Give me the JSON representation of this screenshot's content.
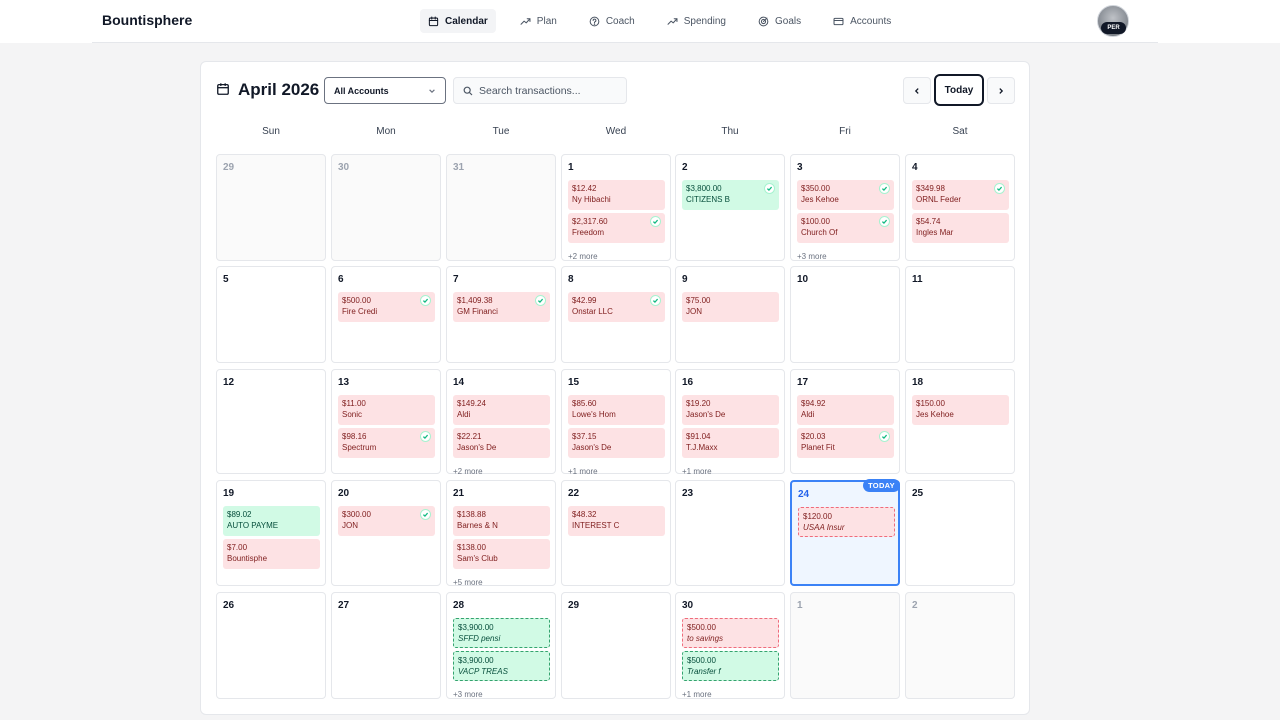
{
  "app": {
    "title": "Bountisphere"
  },
  "nav": [
    {
      "label": "Calendar",
      "icon": "calendar-icon",
      "active": true
    },
    {
      "label": "Plan",
      "icon": "trending-up-icon"
    },
    {
      "label": "Coach",
      "icon": "coach-icon"
    },
    {
      "label": "Spending",
      "icon": "trending-up-icon"
    },
    {
      "label": "Goals",
      "icon": "target-icon"
    },
    {
      "label": "Accounts",
      "icon": "credit-card-icon"
    }
  ],
  "user": {
    "badge": "PER"
  },
  "toolbar": {
    "month": "April 2026",
    "account_filter": "All Accounts",
    "search_placeholder": "Search transactions...",
    "today_label": "Today"
  },
  "weekdays": [
    "Sun",
    "Mon",
    "Tue",
    "Wed",
    "Thu",
    "Fri",
    "Sat"
  ],
  "today_badge": "TODAY",
  "days": [
    {
      "num": "29",
      "other": true,
      "txns": []
    },
    {
      "num": "30",
      "other": true,
      "txns": []
    },
    {
      "num": "31",
      "other": true,
      "txns": []
    },
    {
      "num": "1",
      "txns": [
        {
          "amount": "$12.42",
          "name": "Ny Hibachi",
          "type": "expense"
        },
        {
          "amount": "$2,317.60",
          "name": "Freedom",
          "type": "expense",
          "cleared": true
        }
      ],
      "more": "+2 more"
    },
    {
      "num": "2",
      "txns": [
        {
          "amount": "$3,800.00",
          "name": "CITIZENS B",
          "type": "income",
          "cleared": true
        }
      ]
    },
    {
      "num": "3",
      "txns": [
        {
          "amount": "$350.00",
          "name": "Jes Kehoe",
          "type": "expense",
          "cleared": true
        },
        {
          "amount": "$100.00",
          "name": "Church Of",
          "type": "expense",
          "cleared": true
        }
      ],
      "more": "+3 more"
    },
    {
      "num": "4",
      "txns": [
        {
          "amount": "$349.98",
          "name": "ORNL Feder",
          "type": "expense",
          "cleared": true
        },
        {
          "amount": "$54.74",
          "name": "Ingles Mar",
          "type": "expense"
        }
      ]
    },
    {
      "num": "5",
      "txns": []
    },
    {
      "num": "6",
      "txns": [
        {
          "amount": "$500.00",
          "name": "Fire Credi",
          "type": "expense",
          "cleared": true
        }
      ]
    },
    {
      "num": "7",
      "txns": [
        {
          "amount": "$1,409.38",
          "name": "GM Financi",
          "type": "expense",
          "cleared": true
        }
      ]
    },
    {
      "num": "8",
      "txns": [
        {
          "amount": "$42.99",
          "name": "Onstar LLC",
          "type": "expense",
          "cleared": true
        }
      ]
    },
    {
      "num": "9",
      "txns": [
        {
          "amount": "$75.00",
          "name": "JON",
          "type": "expense"
        }
      ]
    },
    {
      "num": "10",
      "txns": []
    },
    {
      "num": "11",
      "txns": []
    },
    {
      "num": "12",
      "txns": []
    },
    {
      "num": "13",
      "txns": [
        {
          "amount": "$11.00",
          "name": "Sonic",
          "type": "expense"
        },
        {
          "amount": "$98.16",
          "name": "Spectrum",
          "type": "expense",
          "cleared": true
        }
      ]
    },
    {
      "num": "14",
      "txns": [
        {
          "amount": "$149.24",
          "name": "Aldi",
          "type": "expense"
        },
        {
          "amount": "$22.21",
          "name": "Jason's De",
          "type": "expense"
        }
      ],
      "more": "+2 more"
    },
    {
      "num": "15",
      "txns": [
        {
          "amount": "$85.60",
          "name": "Lowe's Hom",
          "type": "expense"
        },
        {
          "amount": "$37.15",
          "name": "Jason's De",
          "type": "expense"
        }
      ],
      "more": "+1 more"
    },
    {
      "num": "16",
      "txns": [
        {
          "amount": "$19.20",
          "name": "Jason's De",
          "type": "expense"
        },
        {
          "amount": "$91.04",
          "name": "T.J.Maxx",
          "type": "expense"
        }
      ],
      "more": "+1 more"
    },
    {
      "num": "17",
      "txns": [
        {
          "amount": "$94.92",
          "name": "Aldi",
          "type": "expense"
        },
        {
          "amount": "$20.03",
          "name": "Planet Fit",
          "type": "expense",
          "cleared": true
        }
      ]
    },
    {
      "num": "18",
      "txns": [
        {
          "amount": "$150.00",
          "name": "Jes Kehoe",
          "type": "expense"
        }
      ]
    },
    {
      "num": "19",
      "txns": [
        {
          "amount": "$89.02",
          "name": "AUTO PAYME",
          "type": "income"
        },
        {
          "amount": "$7.00",
          "name": "Bountisphe",
          "type": "expense"
        }
      ]
    },
    {
      "num": "20",
      "txns": [
        {
          "amount": "$300.00",
          "name": "JON",
          "type": "expense",
          "cleared": true
        }
      ]
    },
    {
      "num": "21",
      "txns": [
        {
          "amount": "$138.88",
          "name": "Barnes & N",
          "type": "expense"
        },
        {
          "amount": "$138.00",
          "name": "Sam's Club",
          "type": "expense"
        }
      ],
      "more": "+5 more"
    },
    {
      "num": "22",
      "txns": [
        {
          "amount": "$48.32",
          "name": "INTEREST C",
          "type": "expense"
        }
      ]
    },
    {
      "num": "23",
      "txns": []
    },
    {
      "num": "24",
      "today": true,
      "txns": [
        {
          "amount": "$120.00",
          "name": "USAA Insur",
          "type": "expense",
          "pending": true
        }
      ]
    },
    {
      "num": "25",
      "txns": []
    },
    {
      "num": "26",
      "txns": []
    },
    {
      "num": "27",
      "txns": []
    },
    {
      "num": "28",
      "txns": [
        {
          "amount": "$3,900.00",
          "name": "SFFD pensi",
          "type": "income",
          "pending": true
        },
        {
          "amount": "$3,900.00",
          "name": "VACP TREAS",
          "type": "income",
          "pending": true
        }
      ],
      "more": "+3 more"
    },
    {
      "num": "29",
      "txns": []
    },
    {
      "num": "30",
      "txns": [
        {
          "amount": "$500.00",
          "name": "to savings",
          "type": "expense",
          "pending": true
        },
        {
          "amount": "$500.00",
          "name": "Transfer f",
          "type": "income",
          "pending": true
        }
      ],
      "more": "+1 more"
    },
    {
      "num": "1",
      "other": true,
      "txns": []
    },
    {
      "num": "2",
      "other": true,
      "txns": []
    }
  ],
  "colors": {
    "expense_bg": "#fde2e4",
    "income_bg": "#d1fae5",
    "today_accent": "#3b82f6"
  }
}
